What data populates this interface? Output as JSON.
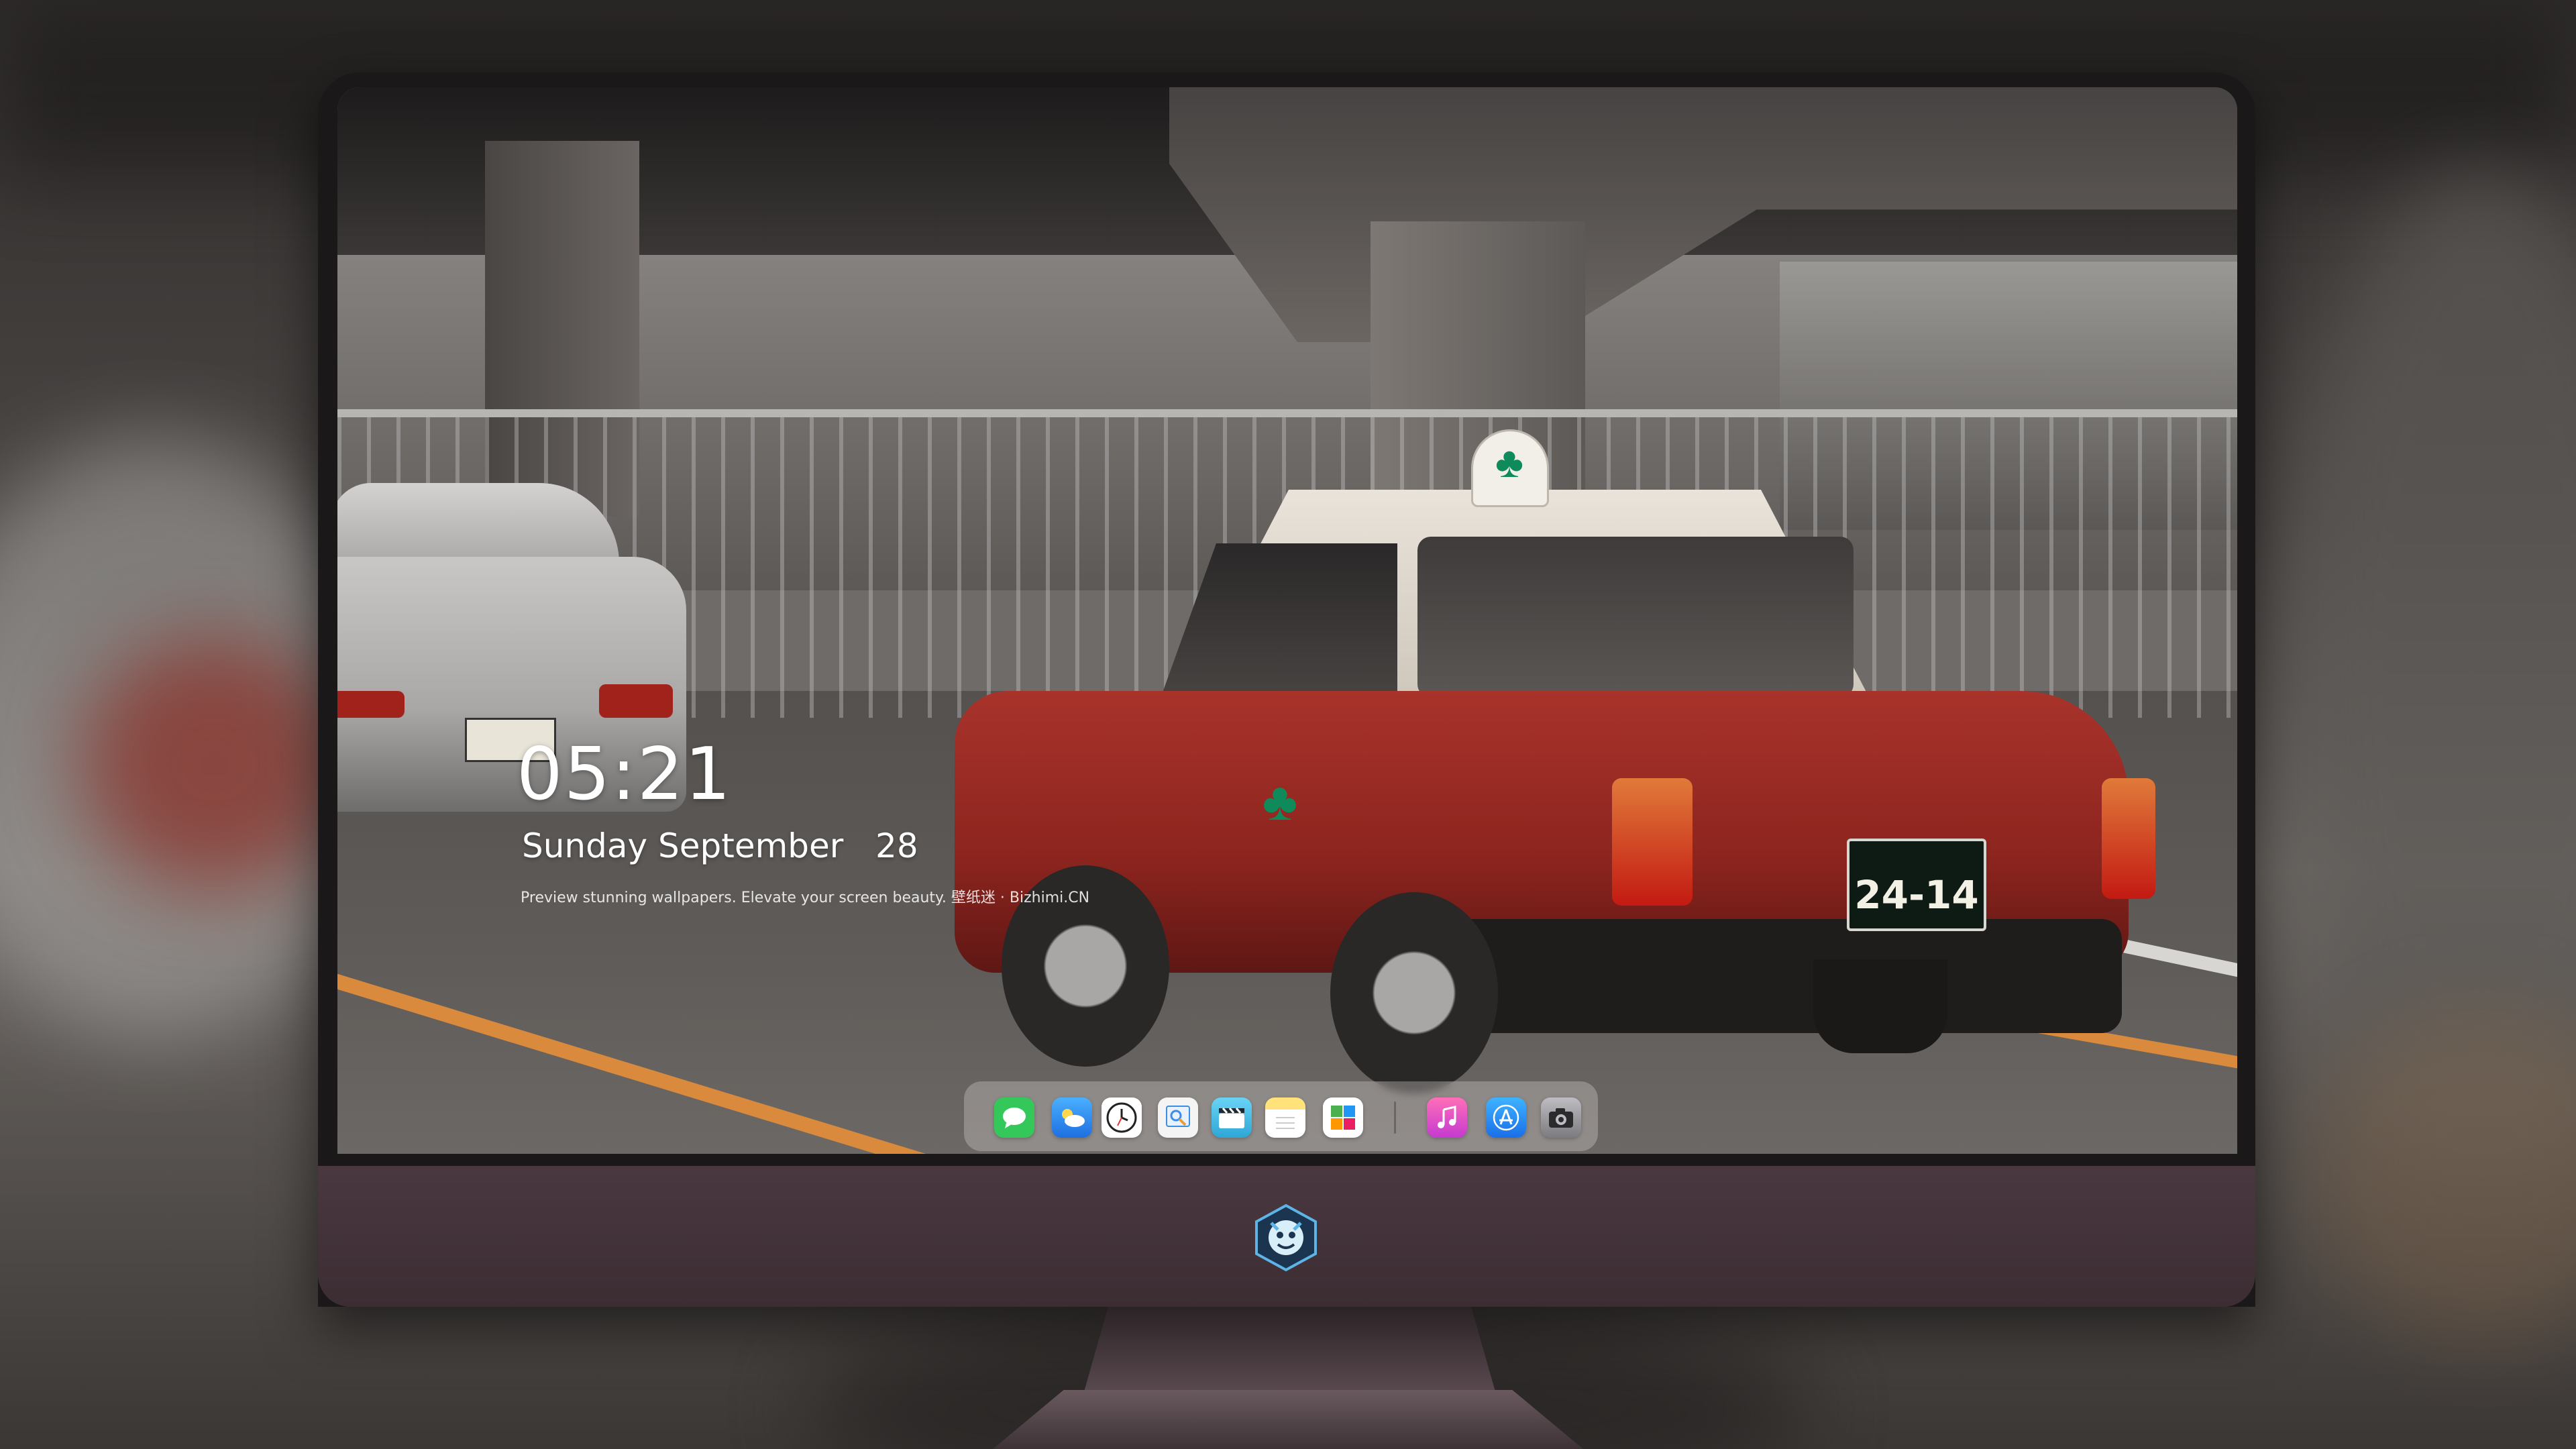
{
  "lockscreen": {
    "time": "05:21",
    "date": "Sunday September   28",
    "tagline": "Preview stunning wallpapers. Elevate your screen beauty. 壁纸迷 · Bizhimi.CN"
  },
  "wallpaper": {
    "taxi_plate": "24-14"
  },
  "dock": {
    "apps": [
      {
        "name": "messages-icon",
        "color": "#34c759"
      },
      {
        "name": "weather-icon",
        "color": "#2d8cf0"
      },
      {
        "name": "clock-icon",
        "color": "#ffffff"
      },
      {
        "name": "preview-icon",
        "color": "#3a8ee6"
      },
      {
        "name": "video-icon",
        "color": "#4fc3e8"
      },
      {
        "name": "notes-icon",
        "color": "#ffd84d"
      },
      {
        "name": "photos-icon",
        "color": "#ffffff"
      },
      {
        "name": "music-icon",
        "color": "#ff4fa0"
      },
      {
        "name": "app-store-icon",
        "color": "#1e90ff"
      },
      {
        "name": "camera-icon",
        "color": "#8e8e93"
      }
    ]
  }
}
